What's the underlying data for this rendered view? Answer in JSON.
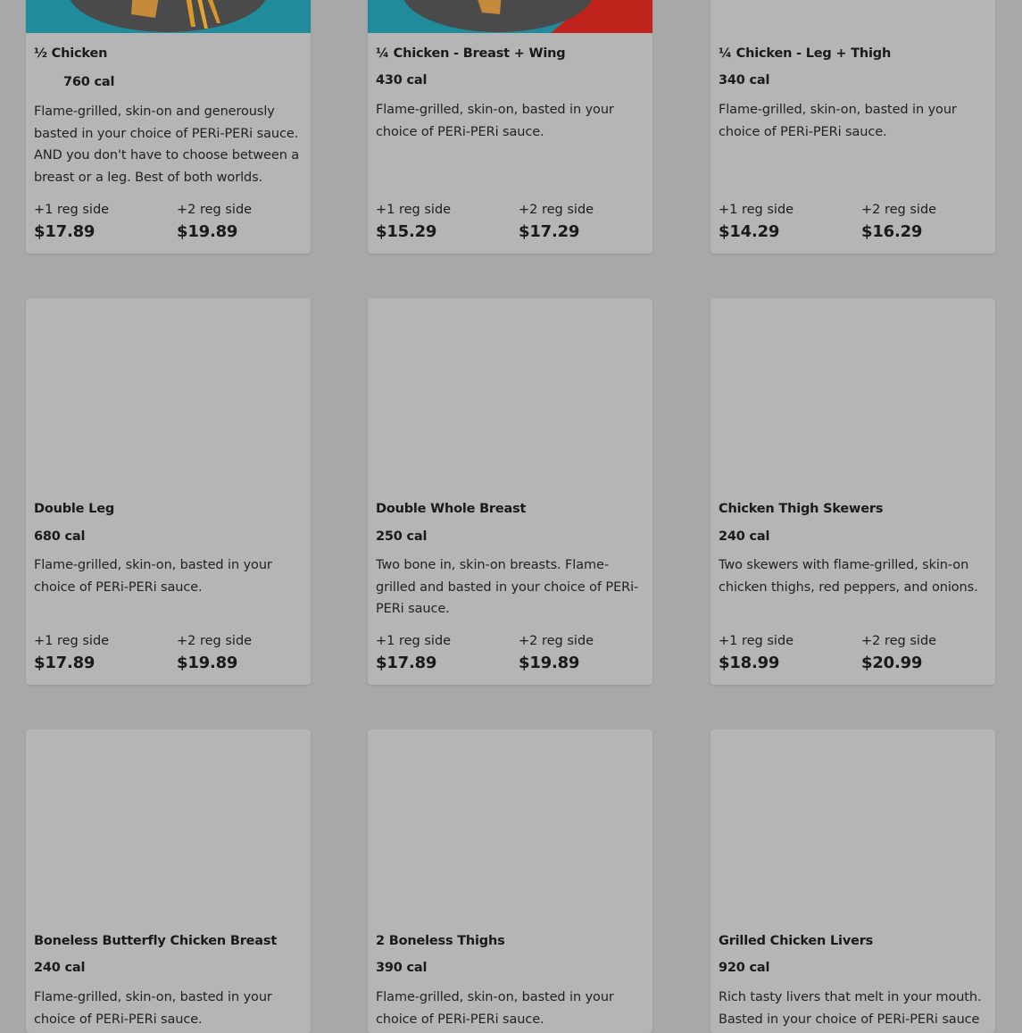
{
  "menu": {
    "items": [
      {
        "name": "½ Chicken",
        "cal": "760 cal",
        "desc": "Flame-grilled, skin-on and generously basted in your choice of PERi-PERi sauce. AND you don't have to choose between a breast or a leg. Best of both worlds.",
        "opt1_label": "+1 reg side",
        "opt1_price": "$17.89",
        "opt2_label": "+2 reg side",
        "opt2_price": "$19.89",
        "image": "half-chicken-photo"
      },
      {
        "name": "¼ Chicken - Breast + Wing",
        "cal": "430 cal",
        "desc": "Flame-grilled, skin-on, basted in your choice of PERi-PERi sauce.",
        "opt1_label": "+1 reg side",
        "opt1_price": "$15.29",
        "opt2_label": "+2 reg side",
        "opt2_price": "$17.29",
        "image": "quarter-chicken-breast-wing-photo"
      },
      {
        "name": "¼ Chicken - Leg + Thigh",
        "cal": "340 cal",
        "desc": "Flame-grilled, skin-on, basted in your choice of PERi-PERi sauce.",
        "opt1_label": "+1 reg side",
        "opt1_price": "$14.29",
        "opt2_label": "+2 reg side",
        "opt2_price": "$16.29",
        "image": "blank"
      },
      {
        "name": "Double Leg",
        "cal": "680 cal",
        "desc": "Flame-grilled, skin-on, basted in your choice of PERi-PERi sauce.",
        "opt1_label": "+1 reg side",
        "opt1_price": "$17.89",
        "opt2_label": "+2 reg side",
        "opt2_price": "$19.89",
        "image": "blank"
      },
      {
        "name": "Double Whole Breast",
        "cal": "250 cal",
        "desc": "Two bone in, skin-on breasts. Flame-grilled and basted in your choice of PERi-PERi sauce.",
        "opt1_label": "+1 reg side",
        "opt1_price": "$17.89",
        "opt2_label": "+2 reg side",
        "opt2_price": "$19.89",
        "image": "blank"
      },
      {
        "name": "Chicken Thigh Skewers",
        "cal": "240 cal",
        "desc": "Two skewers with flame-grilled, skin-on chicken thighs, red peppers, and onions.",
        "opt1_label": "+1 reg side",
        "opt1_price": "$18.99",
        "opt2_label": "+2 reg side",
        "opt2_price": "$20.99",
        "image": "blank"
      },
      {
        "name": "Boneless Butterfly Chicken Breast",
        "cal": "240 cal",
        "desc": "Flame-grilled, skin-on, basted in your choice of PERi-PERi sauce.",
        "opt1_label": "",
        "opt1_price": "",
        "opt2_label": "",
        "opt2_price": "",
        "image": "blank"
      },
      {
        "name": "2 Boneless Thighs",
        "cal": "390 cal",
        "desc": "Flame-grilled, skin-on, basted in your choice of PERi-PERi sauce.",
        "opt1_label": "",
        "opt1_price": "",
        "opt2_label": "",
        "opt2_price": "",
        "image": "blank"
      },
      {
        "name": "Grilled Chicken Livers",
        "cal": "920 cal",
        "desc": "Rich tasty livers that melt in your mouth. Basted in your choice of PERi-PERi sauce",
        "opt1_label": "",
        "opt1_price": "",
        "opt2_label": "",
        "opt2_price": "",
        "image": "blank"
      }
    ]
  },
  "colors": {
    "page_background": "#a8a8a8",
    "card_background": "#b5b5b5",
    "photo_teal": "#1f8b9b",
    "plate_gray": "#4a4a4a",
    "sauce_red": "#c0221c"
  }
}
